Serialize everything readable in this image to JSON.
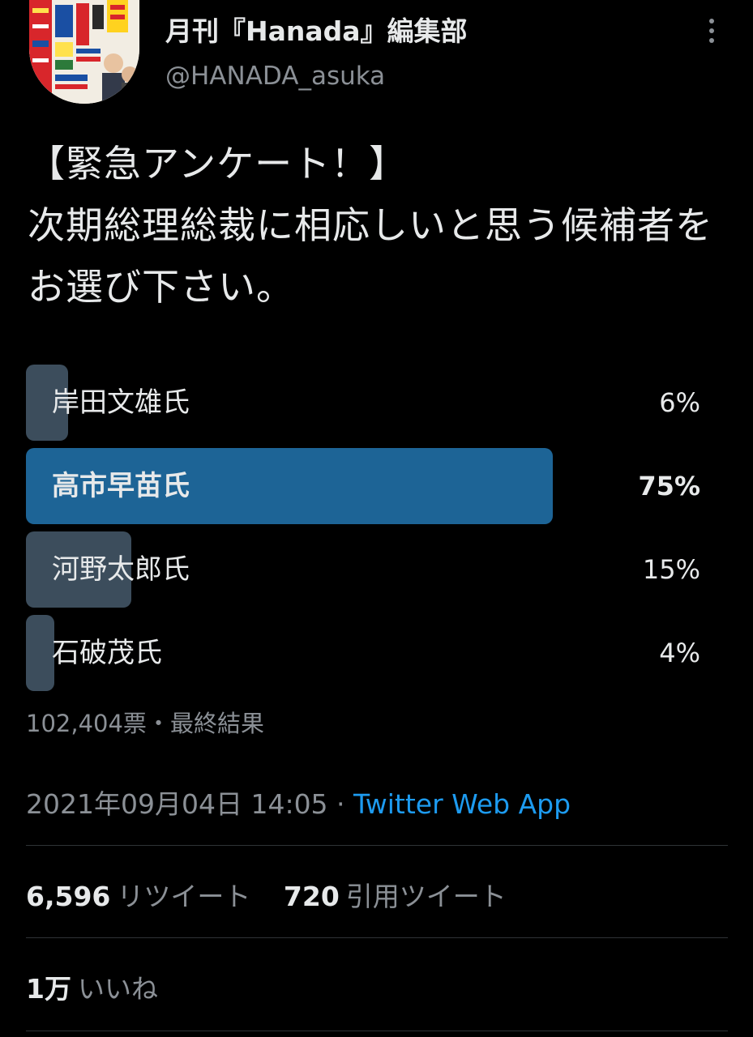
{
  "author": {
    "name": "月刊『Hanada』編集部",
    "handle": "@HANADA_asuka",
    "avatar_icon": "magazine-cover-avatar"
  },
  "menu_icon": "more-vertical-icon",
  "tweet": {
    "text": "【緊急アンケート！】\n次期総理総裁に相応しいと思う候補者をお選び下さい。"
  },
  "poll": {
    "options": [
      {
        "label": "岸田文雄氏",
        "percent_text": "6%",
        "percent": 6,
        "winner": false
      },
      {
        "label": "高市早苗氏",
        "percent_text": "75%",
        "percent": 75,
        "winner": true
      },
      {
        "label": "河野太郎氏",
        "percent_text": "15%",
        "percent": 15,
        "winner": false
      },
      {
        "label": "石破茂氏",
        "percent_text": "4%",
        "percent": 4,
        "winner": false
      }
    ],
    "votes": "102,404票",
    "separator": "・",
    "status": "最終結果"
  },
  "timestamp": {
    "datetime": "2021年09月04日 14:05",
    "separator": " · ",
    "source": "Twitter Web App"
  },
  "stats": {
    "retweets": {
      "count": "6,596",
      "label": "リツイート"
    },
    "quotes": {
      "count": "720",
      "label": "引用ツイート"
    },
    "likes": {
      "count": "1万",
      "label": "いいね"
    }
  },
  "colors": {
    "background": "#000000",
    "text": "#e7e9ea",
    "secondary_text": "#8b9096",
    "link": "#1d9bf0",
    "poll_bar": "#3c4d5c",
    "poll_bar_winner": "#1d6496",
    "divider": "#2f3336"
  }
}
